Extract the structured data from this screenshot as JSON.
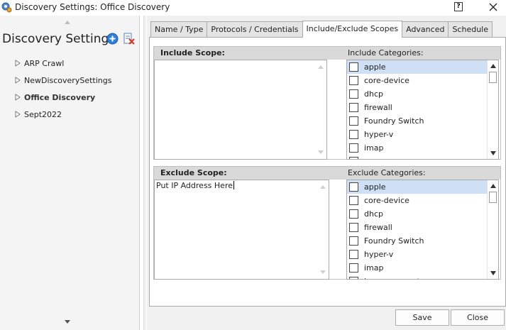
{
  "window": {
    "title": "Discovery Settings: Office Discovery",
    "help_label": "?"
  },
  "sidebar": {
    "title": "Discovery Settings",
    "items": [
      {
        "label": "ARP Crawl",
        "bold": false
      },
      {
        "label": "NewDiscoverySettings",
        "bold": false
      },
      {
        "label": "Office Discovery",
        "bold": true
      },
      {
        "label": "Sept2022",
        "bold": false
      }
    ]
  },
  "tabs": [
    {
      "label": "Name / Type",
      "active": false
    },
    {
      "label": "Protocols / Credentials",
      "active": false
    },
    {
      "label": "Include/Exclude Scopes",
      "active": true
    },
    {
      "label": "Advanced",
      "active": false
    },
    {
      "label": "Schedule",
      "active": false
    }
  ],
  "include": {
    "scope_label": "Include Scope:",
    "scope_value": "",
    "categories_label": "Include Categories:",
    "categories": [
      "apple",
      "core-device",
      "dhcp",
      "firewall",
      "Foundry Switch",
      "hyper-v",
      "imap"
    ],
    "selected_index": 0
  },
  "exclude": {
    "scope_label": "Exclude Scope:",
    "scope_value": "Put IP Address Here",
    "categories_label": "Exclude Categories:",
    "categories": [
      "apple",
      "core-device",
      "dhcp",
      "firewall",
      "Foundry Switch",
      "hyper-v",
      "imap",
      "ip_camera_cctv"
    ],
    "selected_index": 0
  },
  "buttons": {
    "save": "Save",
    "close": "Close"
  },
  "colors": {
    "selection": "#cfdff5",
    "section_header": "#d9d9d9",
    "add_icon": "#2f7fd8",
    "delete_icon": "#d23a2a"
  }
}
